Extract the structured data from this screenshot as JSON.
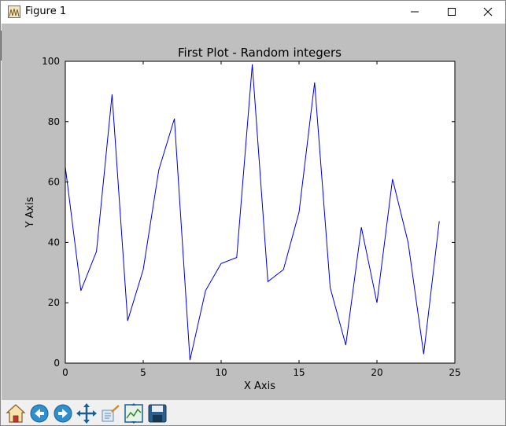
{
  "window": {
    "title": "Figure 1"
  },
  "colors": {
    "figure_bg": "#bfbfbf",
    "plot_bg": "#ffffff",
    "line": "#0000cc"
  },
  "icons": [
    "home-icon",
    "back-icon",
    "forward-icon",
    "pan-icon",
    "zoom-icon",
    "configure-subplots-icon",
    "save-icon"
  ],
  "chart_data": {
    "type": "line",
    "title": "First Plot - Random integers",
    "xlabel": "X Axis",
    "ylabel": "Y Axis",
    "xlim": [
      0,
      25
    ],
    "ylim": [
      0,
      100
    ],
    "xticks": [
      "0",
      "5",
      "10",
      "15",
      "20",
      "25"
    ],
    "yticks": [
      "0",
      "20",
      "40",
      "60",
      "80",
      "100"
    ],
    "grid": false,
    "series": [
      {
        "x": [
          0,
          1,
          2,
          3,
          4,
          5,
          6,
          7,
          8,
          9,
          10,
          11,
          12,
          13,
          14,
          15,
          16,
          17,
          18,
          19,
          20,
          21,
          22,
          23,
          24
        ],
        "values": [
          65,
          24,
          37,
          89,
          14,
          31,
          64,
          81,
          1,
          24,
          33,
          35,
          99,
          27,
          31,
          50,
          93,
          25,
          6,
          45,
          20,
          61,
          40,
          3,
          47
        ]
      }
    ]
  }
}
